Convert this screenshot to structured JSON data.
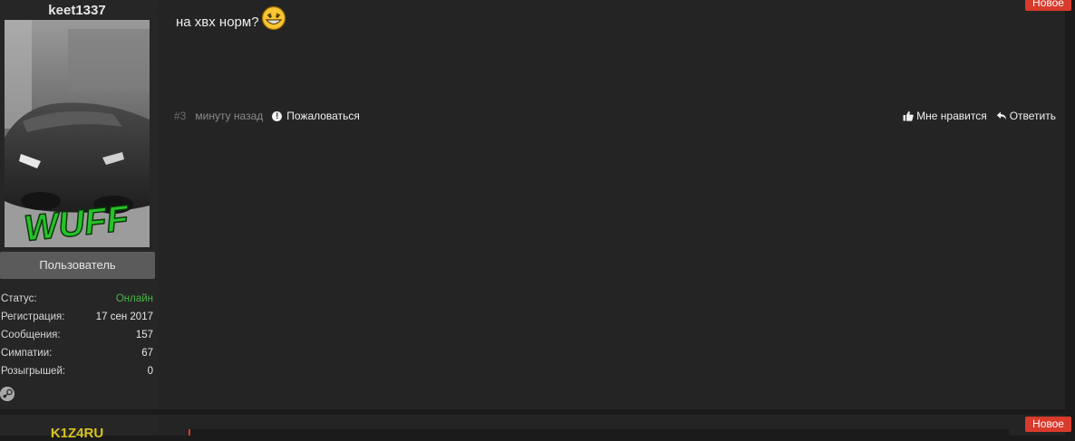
{
  "post1": {
    "username": "keet1337",
    "rank": "Пользователь",
    "stats": [
      {
        "label": "Статус:",
        "value": "Онлайн",
        "type": "online"
      },
      {
        "label": "Регистрация:",
        "value": "17 сен 2017",
        "type": "normal"
      },
      {
        "label": "Сообщения:",
        "value": "157",
        "type": "normal"
      },
      {
        "label": "Симпатии:",
        "value": "67",
        "type": "normal"
      },
      {
        "label": "Розыгрышей:",
        "value": "0",
        "type": "normal"
      }
    ],
    "message": "на хвх норм?",
    "post_number": "#3",
    "time": "минуту назад",
    "report_label": "Пожаловаться",
    "like_label": "Мне нравится",
    "reply_label": "Ответить",
    "new_badge": "Новое",
    "avatar_text": "WUFF"
  },
  "post2": {
    "username": "K1Z4RU",
    "new_badge": "Новое"
  },
  "colors": {
    "background": "#1b1b1b",
    "panel": "#262626",
    "post_body": "#242424",
    "online": "#4bb54b",
    "badge": "#d83a2b",
    "username2": "#d8c31e",
    "avatar_text": "#27c22a"
  },
  "icons": {
    "smiley": "grinning-smiley-icon",
    "report": "exclamation-circle-icon",
    "like": "thumbs-up-icon",
    "reply": "reply-arrow-icon",
    "steam": "steam-icon"
  }
}
